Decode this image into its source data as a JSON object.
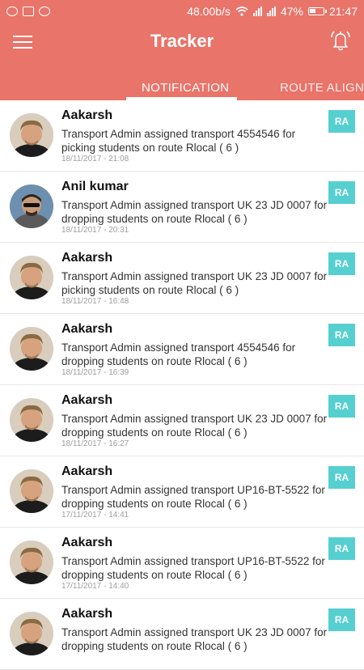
{
  "status_bar": {
    "left_icons": [
      "whatsapp-icon",
      "gallery-icon",
      "sync-icon"
    ],
    "speed": "48.00b/s",
    "battery": "47%",
    "time": "21:47"
  },
  "header": {
    "title": "Tracker",
    "menu_icon": "menu-icon",
    "bell_icon": "alarm-bell-icon"
  },
  "tabs": [
    {
      "label": "NOTIFICATION",
      "active": true
    },
    {
      "label": "ROUTE ALIGNM"
    }
  ],
  "notifications": [
    {
      "name": "Aakarsh",
      "message": "Transport Admin assigned  transport 4554546 for picking students on route Rlocal ( 6 )",
      "time": "18/11/2017 - 21:08",
      "badge": "RA"
    },
    {
      "name": "Anil kumar",
      "message": "Transport Admin assigned  transport UK 23 JD 0007 for dropping students on route Rlocal ( 6 )",
      "time": "18/11/2017 - 20:31",
      "badge": "RA"
    },
    {
      "name": "Aakarsh",
      "message": "Transport Admin assigned  transport UK 23 JD 0007 for picking students on route Rlocal ( 6 )",
      "time": "18/11/2017 - 16:48",
      "badge": "RA"
    },
    {
      "name": "Aakarsh",
      "message": "Transport Admin assigned  transport 4554546 for dropping students on route Rlocal ( 6 )",
      "time": "18/11/2017 - 16:39",
      "badge": "RA"
    },
    {
      "name": "Aakarsh",
      "message": "Transport Admin assigned  transport UK 23 JD 0007 for dropping students on route Rlocal ( 6 )",
      "time": "18/11/2017 - 16:27",
      "badge": "RA"
    },
    {
      "name": "Aakarsh",
      "message": "Transport Admin assigned  transport UP16-BT-5522 for dropping students on route Rlocal ( 6 )",
      "time": "17/11/2017 - 14:41",
      "badge": "RA"
    },
    {
      "name": "Aakarsh",
      "message": "Transport Admin assigned  transport UP16-BT-5522 for dropping students on route Rlocal ( 6 )",
      "time": "17/11/2017 - 14:40",
      "badge": "RA"
    },
    {
      "name": "Aakarsh",
      "message": "Transport Admin assigned  transport UK 23 JD 0007 for dropping students on route Rlocal ( 6 )",
      "time": "",
      "badge": "RA"
    }
  ],
  "colors": {
    "primary": "#e8746a",
    "badge": "#56cfd0"
  }
}
